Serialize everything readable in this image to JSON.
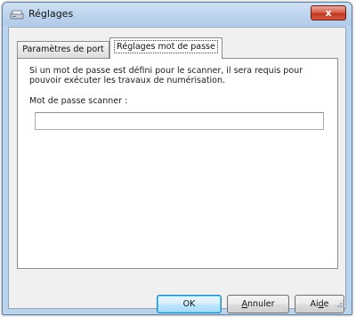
{
  "window": {
    "title": "Réglages",
    "close_label": "x"
  },
  "tabs": [
    {
      "label": "Paramètres de port",
      "active": false
    },
    {
      "label": "Réglages mot de passe",
      "active": true
    }
  ],
  "password_panel": {
    "description": "Si un mot de passe est défini pour le scanner, il sera requis pour pouvoir exécuter les travaux de numérisation.",
    "field_label": "Mot de passe scanner :",
    "field_value": ""
  },
  "buttons": {
    "ok_label": "OK",
    "cancel_prefix": "",
    "cancel_mnemonic": "A",
    "cancel_rest": "nnuler",
    "help_prefix": "Ai",
    "help_mnemonic": "d",
    "help_rest": "e"
  },
  "icons": {
    "app": "scanner-icon",
    "close": "close-icon",
    "resize": "resize-grip-icon"
  }
}
